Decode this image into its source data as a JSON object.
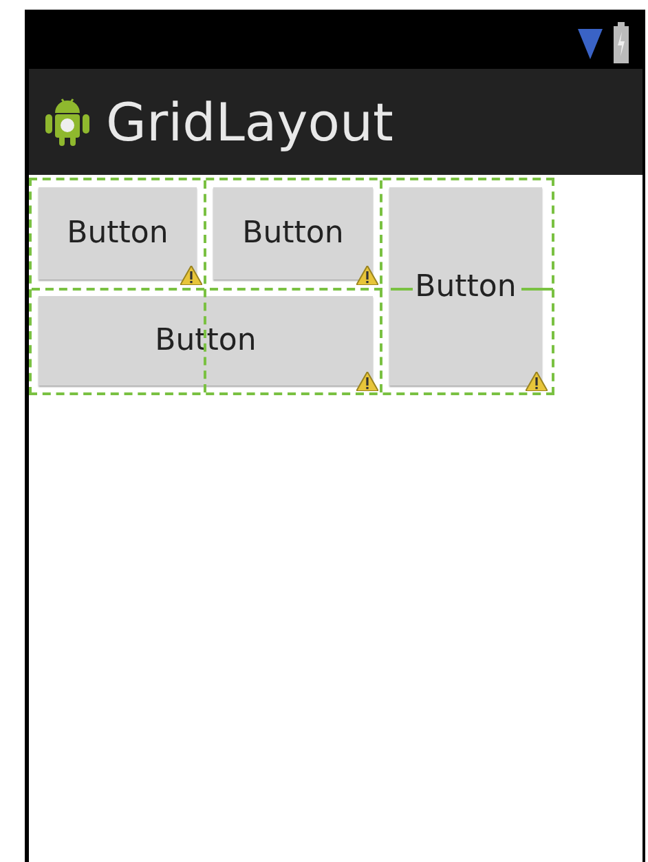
{
  "action_bar": {
    "title": "GridLayout"
  },
  "grid_buttons": [
    {
      "label": "Button",
      "kind": "normal",
      "warning": true
    },
    {
      "label": "Button",
      "kind": "normal",
      "warning": true
    },
    {
      "label": "Button",
      "kind": "tall",
      "warning": true
    },
    {
      "label": "Button",
      "kind": "wide",
      "warning": true
    }
  ]
}
